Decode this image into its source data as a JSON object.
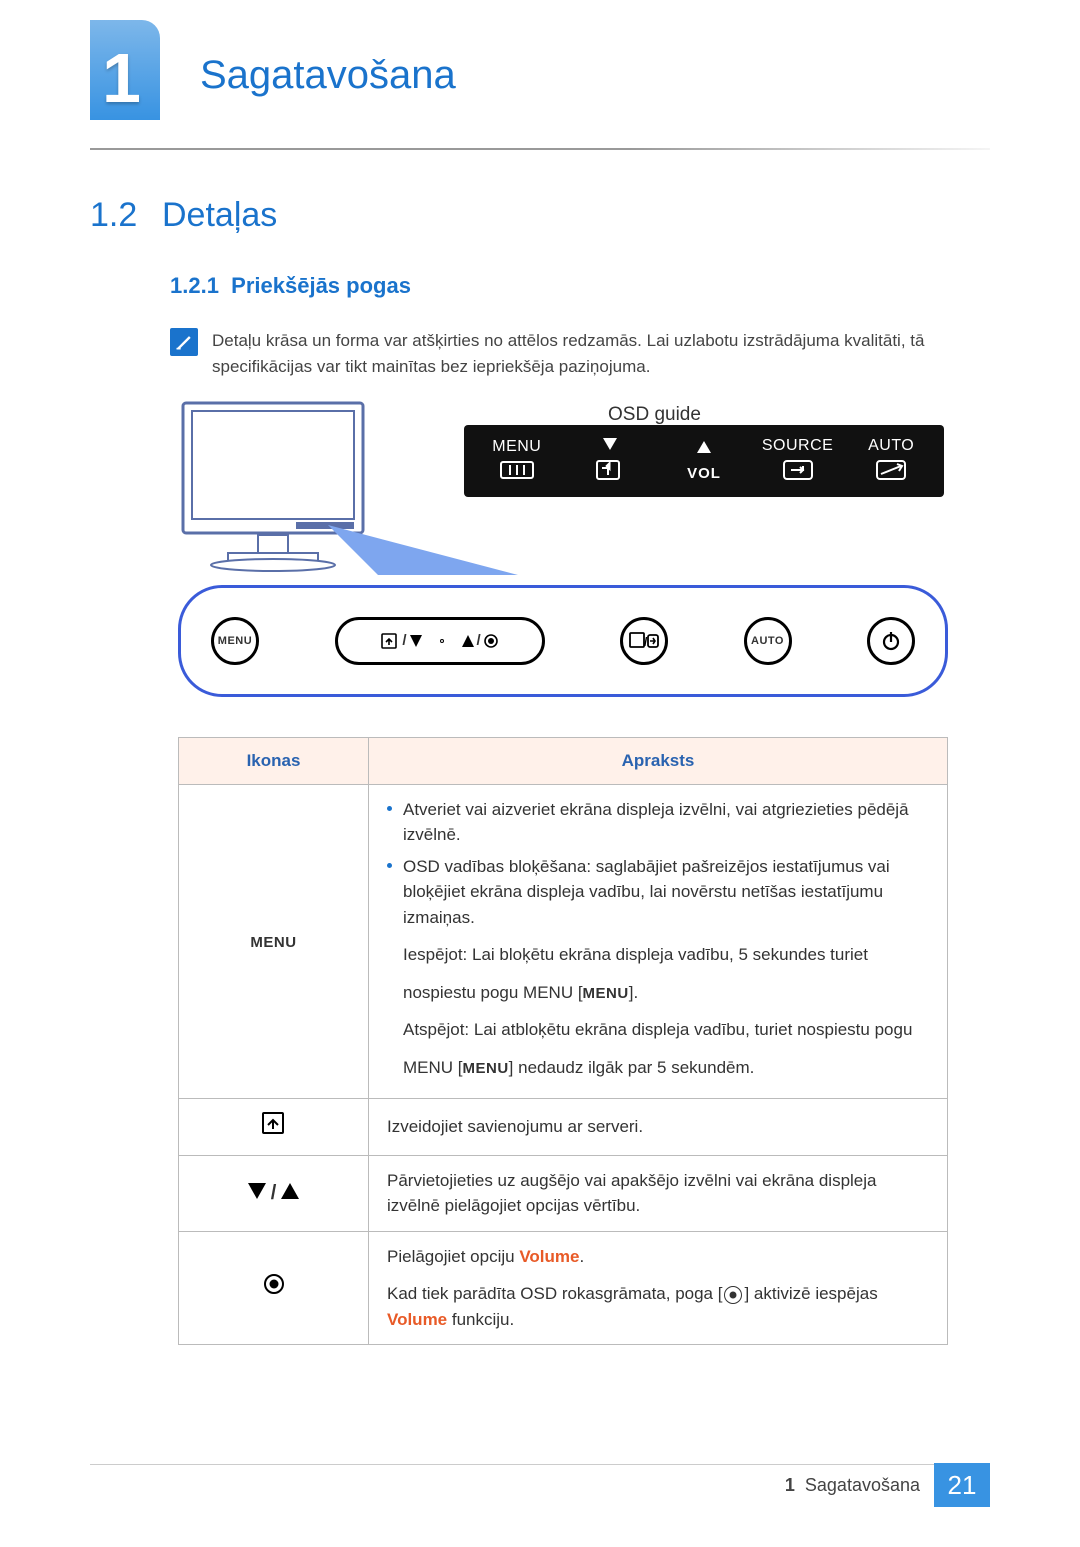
{
  "chapter": {
    "number": "1",
    "title": "Sagatavošana"
  },
  "section": {
    "number": "1.2",
    "title": "Detaļas"
  },
  "subsection": {
    "number": "1.2.1",
    "title": "Priekšējās pogas"
  },
  "note": {
    "text": "Detaļu krāsa un forma var atšķirties no attēlos redzamās. Lai uzlabotu izstrādājuma kvalitāti, tā specifikācijas var tikt mainītas bez iepriekšēja paziņojuma."
  },
  "figure": {
    "osd_label": "OSD guide",
    "osd_buttons": {
      "menu": "MENU",
      "vol": "VOL",
      "source": "SOURCE",
      "auto": "AUTO"
    },
    "panel_buttons": {
      "menu": "MENU",
      "auto": "AUTO"
    }
  },
  "table": {
    "head_icons": "Ikonas",
    "head_desc": "Apraksts",
    "rows": {
      "menu": {
        "icon_text": "MENU",
        "b1": "Atveriet vai aizveriet ekrāna displeja izvēlni, vai atgriezieties pēdējā izvēlnē.",
        "b2": "OSD vadības bloķēšana: saglabājiet pašreizējos iestatījumus vai bloķējiet ekrāna displeja vadību, lai novērstu netīšas iestatījumu izmaiņas.",
        "p1a": "Iespējot: Lai bloķētu ekrāna displeja vadību, 5 sekundes turiet",
        "p1b_pre": "nospiestu pogu MENU [",
        "p1b_icon": "MENU",
        "p1b_post": "].",
        "p2": "Atspējot: Lai atbloķētu ekrāna displeja vadību, turiet nospiestu pogu",
        "p3_pre": "MENU [",
        "p3_icon": "MENU",
        "p3_post": "] nedaudz ilgāk par 5 sekundēm."
      },
      "server": {
        "desc": "Izveidojiet savienojumu ar serveri."
      },
      "updown": {
        "desc": "Pārvietojieties uz augšējo vai apakšējo izvēlni vai ekrāna displeja izvēlnē pielāgojiet opcijas vērtību."
      },
      "record": {
        "line1_pre": "Pielāgojiet opciju ",
        "line1_hi": "Volume",
        "line1_post": ".",
        "line2_pre": "Kad tiek parādīta OSD rokasgrāmata, poga [",
        "line2_post": "] aktivizē iespējas ",
        "line2_hi": "Volume",
        "line2_end": " funkciju."
      }
    }
  },
  "footer": {
    "crumb_num": "1",
    "crumb_title": "Sagatavošana",
    "page": "21"
  }
}
